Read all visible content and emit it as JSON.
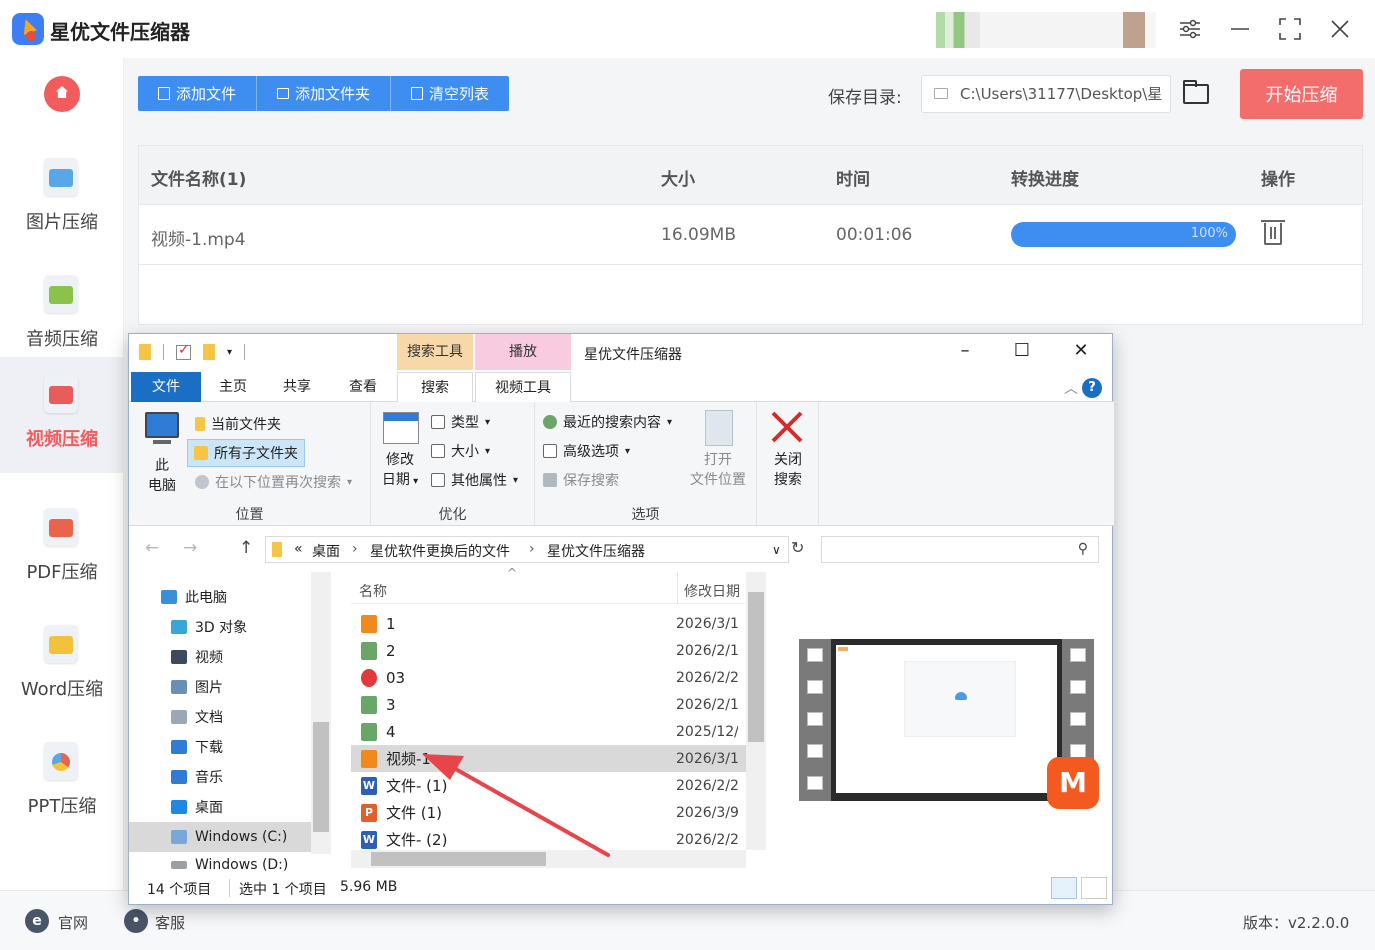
{
  "app": {
    "title": "星优文件压缩器"
  },
  "sidebar": {
    "items": [
      {
        "label": "图片压缩",
        "icon": "image-compress-icon"
      },
      {
        "label": "音频压缩",
        "icon": "audio-compress-icon"
      },
      {
        "label": "视频压缩",
        "icon": "video-compress-icon",
        "active": true
      },
      {
        "label": "PDF压缩",
        "icon": "pdf-compress-icon"
      },
      {
        "label": "Word压缩",
        "icon": "word-compress-icon"
      },
      {
        "label": "PPT压缩",
        "icon": "ppt-compress-icon"
      }
    ]
  },
  "toolbar": {
    "add_file": "添加文件",
    "add_folder": "添加文件夹",
    "clear_list": "清空列表",
    "save_label": "保存目录:",
    "save_path": "C:\\Users\\31177\\Desktop\\星",
    "start": "开始压缩"
  },
  "table": {
    "headers": {
      "name": "文件名称(1)",
      "size": "大小",
      "time": "时间",
      "progress": "转换进度",
      "action": "操作"
    },
    "rows": [
      {
        "name": "视频-1.mp4",
        "size": "16.09MB",
        "time": "00:01:06",
        "progress_text": "100%",
        "progress": 1.0
      }
    ]
  },
  "footer": {
    "website": "官网",
    "service": "客服",
    "version": "版本：v2.2.0.0"
  },
  "explorer": {
    "title": "星优文件压缩器",
    "ctx_search": "搜索工具",
    "ctx_play": "播放",
    "tabs": {
      "file": "文件",
      "home": "主页",
      "share": "共享",
      "view": "查看",
      "search": "搜索",
      "video": "视频工具"
    },
    "ribbon": {
      "this_pc_1": "此",
      "this_pc_2": "电脑",
      "current_folder": "当前文件夹",
      "all_subfolders": "所有子文件夹",
      "search_again": "在以下位置再次搜索",
      "group_location": "位置",
      "date_modified_1": "修改",
      "date_modified_2": "日期",
      "type": "类型",
      "size": "大小",
      "other_props": "其他属性",
      "group_refine": "优化",
      "recent_searches": "最近的搜索内容",
      "advanced": "高级选项",
      "save_search": "保存搜索",
      "open_location_1": "打开",
      "open_location_2": "文件位置",
      "close_search_1": "关闭",
      "close_search_2": "搜索",
      "group_options": "选项"
    },
    "address": {
      "prefix": "«",
      "crumbs": [
        "桌面",
        "星优软件更换后的文件",
        "星优文件压缩器"
      ]
    },
    "tree": [
      {
        "label": "此电脑",
        "color": "#3a8fd8"
      },
      {
        "label": "3D 对象",
        "color": "#39a6d8"
      },
      {
        "label": "视频",
        "color": "#3b4a5c"
      },
      {
        "label": "图片",
        "color": "#6a8fb5"
      },
      {
        "label": "文档",
        "color": "#9aa7b4"
      },
      {
        "label": "下载",
        "color": "#2f7bd6"
      },
      {
        "label": "音乐",
        "color": "#2f7bd6"
      },
      {
        "label": "桌面",
        "color": "#1e88e5"
      },
      {
        "label": "Windows (C:)",
        "color": "#7aa7d8",
        "selected": true
      },
      {
        "label": "Windows (D:)",
        "color": "#9aa0a6"
      }
    ],
    "columns": {
      "name": "名称",
      "date": "修改日期"
    },
    "files": [
      {
        "name": "1",
        "date": "2026/3/1",
        "color": "#f08a1d",
        "glyph": ""
      },
      {
        "name": "2",
        "date": "2026/2/1",
        "color": "#6aa56a",
        "glyph": ""
      },
      {
        "name": "03",
        "date": "2026/2/2",
        "color": "#e03a3a",
        "glyph": ""
      },
      {
        "name": "3",
        "date": "2026/2/1",
        "color": "#6aa56a",
        "glyph": ""
      },
      {
        "name": "4",
        "date": "2025/12/",
        "color": "#6aa56a",
        "glyph": ""
      },
      {
        "name": "视频-1",
        "date": "2026/3/1",
        "color": "#f08a1d",
        "glyph": "",
        "selected": true
      },
      {
        "name": "文件- (1)",
        "date": "2026/2/2",
        "color": "#2b5fb8",
        "glyph": "W"
      },
      {
        "name": "文件 (1)",
        "date": "2026/3/9",
        "color": "#e0602a",
        "glyph": "P"
      },
      {
        "name": "文件- (2)",
        "date": "2026/2/2",
        "color": "#2b5fb8",
        "glyph": "W"
      }
    ],
    "status": {
      "count": "14 个项目",
      "selected": "选中 1 个项目",
      "size": "5.96 MB"
    }
  }
}
